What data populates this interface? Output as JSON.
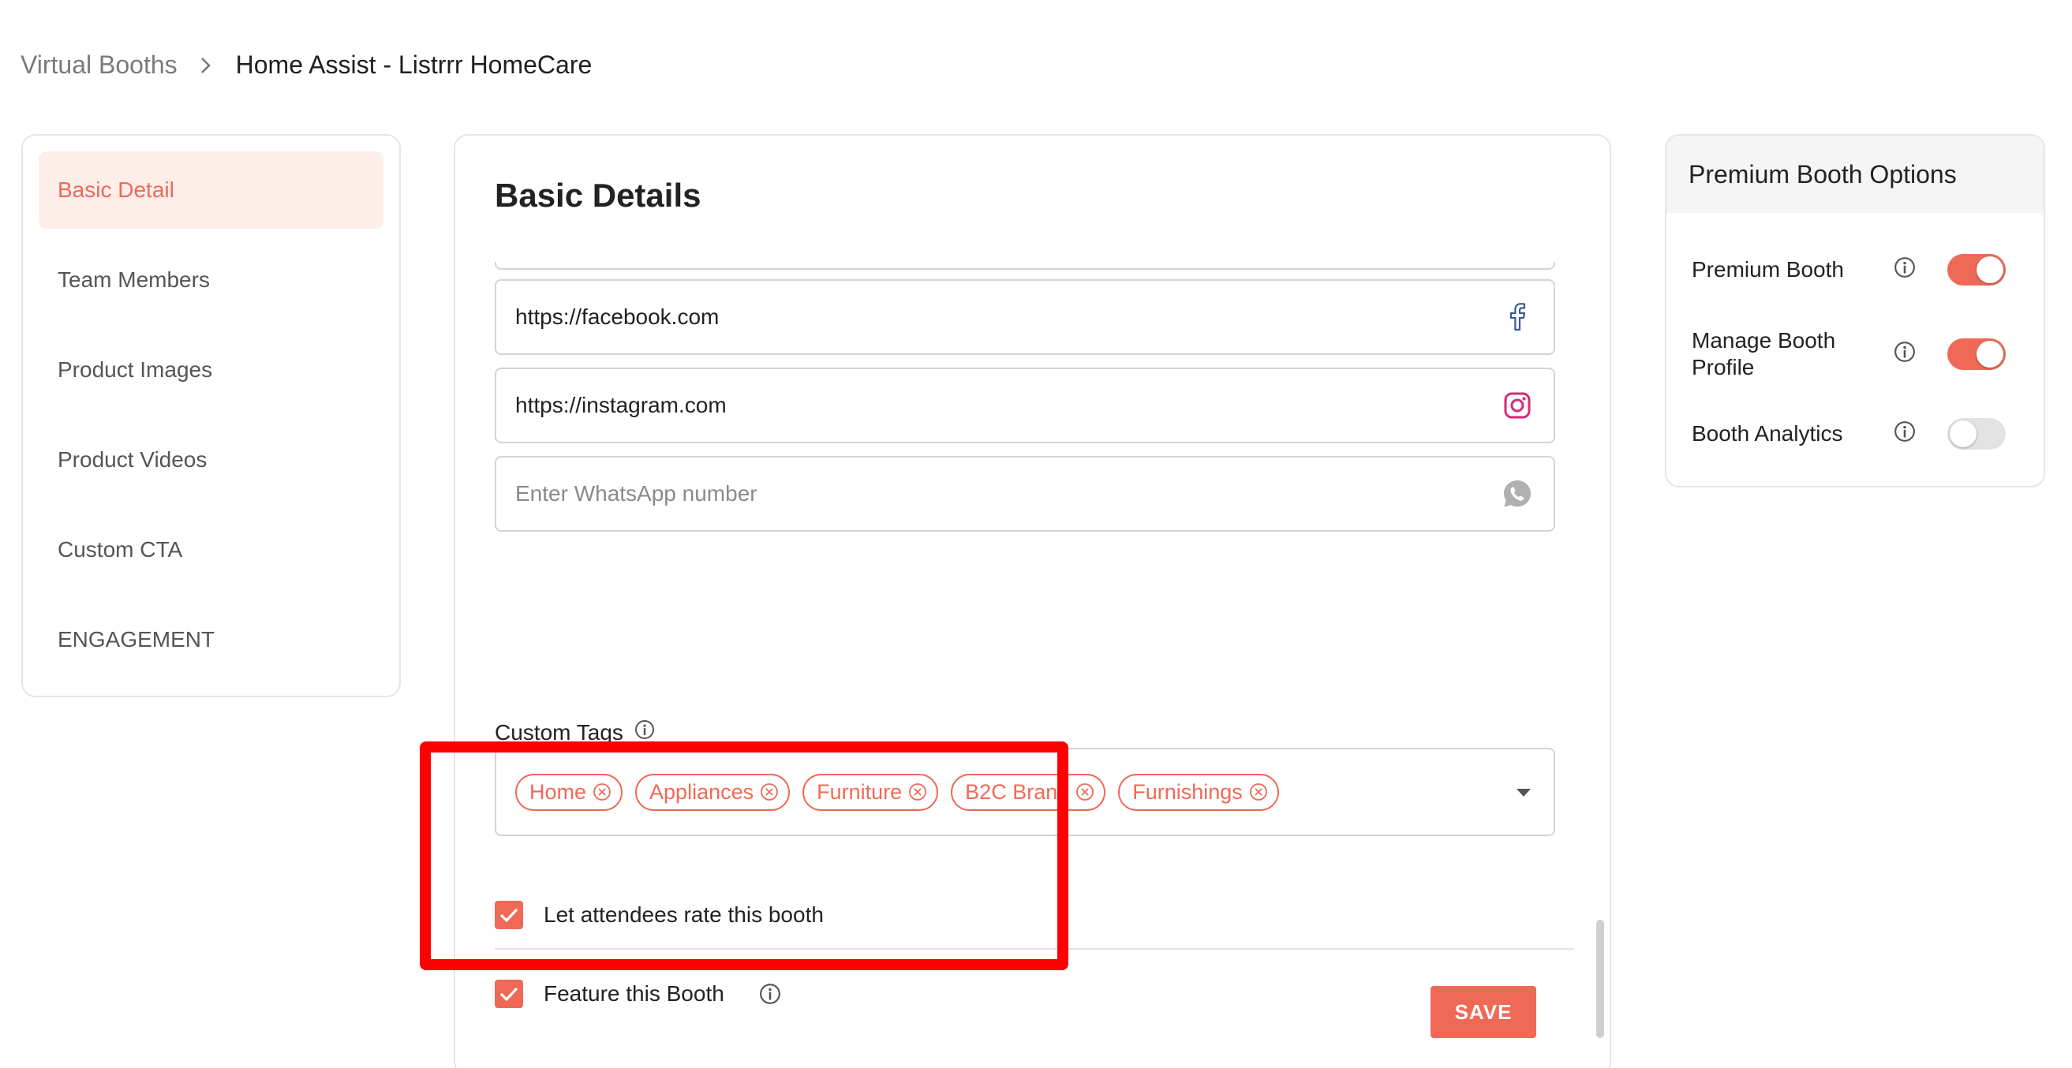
{
  "breadcrumb": {
    "parent": "Virtual Booths",
    "current": "Home Assist - Listrrr HomeCare"
  },
  "sidebar": {
    "items": [
      {
        "label": "Basic Detail",
        "active": true
      },
      {
        "label": "Team Members",
        "active": false
      },
      {
        "label": "Product Images",
        "active": false
      },
      {
        "label": "Product Videos",
        "active": false
      },
      {
        "label": "Custom CTA",
        "active": false
      },
      {
        "label": "ENGAGEMENT",
        "active": false
      }
    ]
  },
  "main": {
    "title": "Basic Details",
    "facebook": {
      "value": "https://facebook.com",
      "icon": "facebook-icon"
    },
    "instagram": {
      "value": "https://instagram.com",
      "icon": "instagram-icon"
    },
    "whatsapp": {
      "value": "",
      "placeholder": "Enter WhatsApp number",
      "icon": "whatsapp-icon"
    },
    "custom_tags": {
      "label": "Custom Tags",
      "tags": [
        "Home",
        "Appliances",
        "Furniture",
        "B2C Brand",
        "Furnishings"
      ]
    },
    "rate_booth": {
      "label": "Let attendees rate this booth",
      "checked": true
    },
    "feature_booth": {
      "label": "Feature this Booth",
      "checked": true
    },
    "save_label": "SAVE"
  },
  "premium": {
    "title": "Premium Booth Options",
    "options": [
      {
        "label": "Premium Booth",
        "enabled": true
      },
      {
        "label": "Manage Booth Profile",
        "enabled": true
      },
      {
        "label": "Booth Analytics",
        "enabled": false
      }
    ]
  },
  "colors": {
    "accent": "#ee6a57",
    "highlight": "#ff0000",
    "facebook": "#3b5998",
    "instagram": "#d62976",
    "whatsapp": "#a9a9a9"
  }
}
